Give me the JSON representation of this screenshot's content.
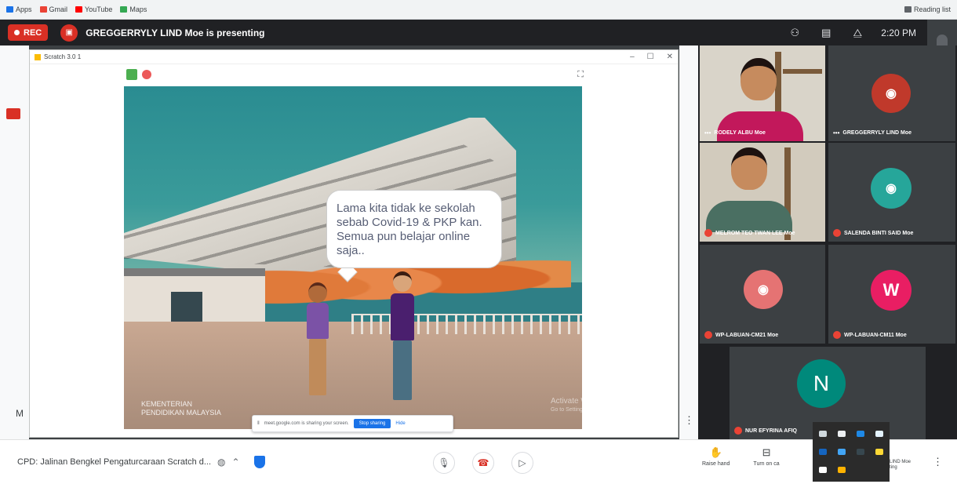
{
  "bookmarks": {
    "items": [
      {
        "label": "Apps",
        "color": "#1a73e8"
      },
      {
        "label": "Gmail",
        "color": "#ea4335"
      },
      {
        "label": "YouTube",
        "color": "#ff0000"
      },
      {
        "label": "Maps",
        "color": "#34a853"
      }
    ],
    "reading_list": "Reading list"
  },
  "meet_top": {
    "rec_label": "REC",
    "presenter_text": "GREGGERRYLY LIND Moe is presenting",
    "time": "2:20 PM",
    "icons": [
      "people-icon",
      "chat-icon",
      "activities-icon"
    ]
  },
  "shared_window": {
    "title": "Scratch 3.0 1",
    "controls": [
      "–",
      "☐",
      "✕"
    ]
  },
  "scratch": {
    "speech_bubble": "Lama kita tidak ke sekolah sebab Covid-19 & PKP kan. Semua pun belajar online saja..",
    "watermark_line1": "KEMENTERIAN",
    "watermark_line2": "PENDIDIKAN MALAYSIA"
  },
  "share_banner": {
    "text": "meet.google.com is sharing your screen.",
    "stop_label": "Stop sharing",
    "hide_label": "Hide"
  },
  "activate_windows": {
    "title": "Activate Windows",
    "subtitle": "Go to Settings to activate Windows."
  },
  "left_strip_letter": "M",
  "participants": [
    {
      "name": "RODELY ALBU Moe",
      "type": "camera"
    },
    {
      "name": "GREGGERRYLY LIND Moe",
      "type": "avatar-photo",
      "avatar_color": "#c0392b"
    },
    {
      "name": "MELROM TEO TWAN LEE Moe",
      "type": "camera"
    },
    {
      "name": "SALENDA BINTI SAID Moe",
      "type": "avatar-photo",
      "avatar_color": "#26a69a"
    },
    {
      "name": "WP-LABUAN-CM21 Moe",
      "type": "avatar-photo",
      "avatar_color": "#e57373"
    },
    {
      "name": "WP-LABUAN-CM11 Moe",
      "type": "avatar-letter",
      "letter": "W",
      "avatar_color": "#e91e63"
    },
    {
      "name": "NUR EFYRINA AFIQ",
      "type": "avatar-letter",
      "letter": "N",
      "avatar_color": "#00897b"
    }
  ],
  "bottom_bar": {
    "meeting_title": "CPD: Jalinan Bengkel Pengaturcaraan Scratch d...",
    "raise_hand": "Raise hand",
    "turn_on_captions": "Turn on ca",
    "presenting_name": "LIND Moe",
    "presenting_sub": "ting"
  },
  "colors": {
    "meet_dark": "#202124",
    "rec_red": "#d93025",
    "accent_blue": "#1a73e8"
  }
}
